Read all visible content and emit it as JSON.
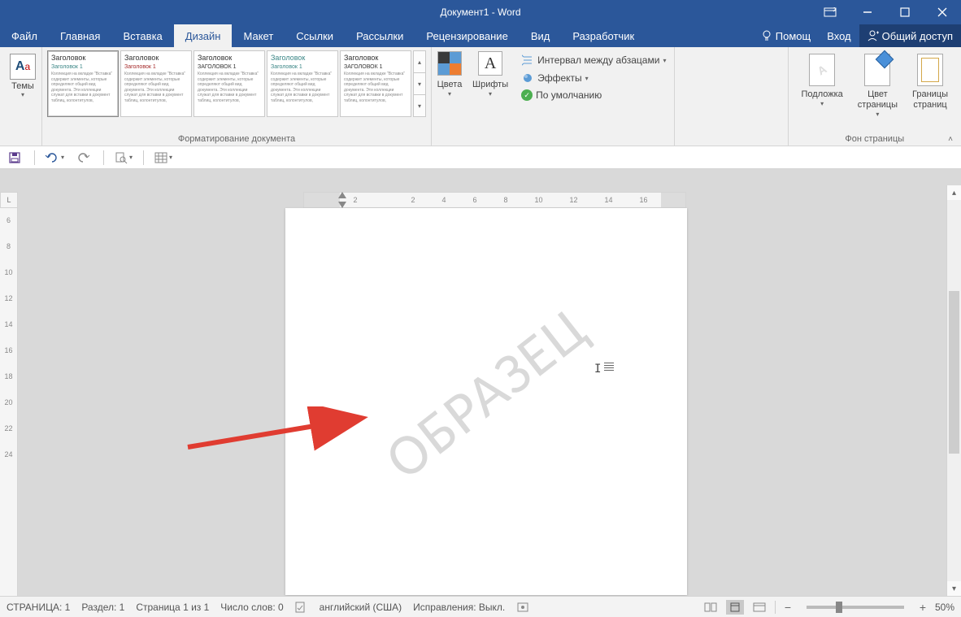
{
  "title": "Документ1 - Word",
  "window_controls": {
    "ribbon_opts": "ribbon-display-options",
    "min": "minimize",
    "max": "maximize",
    "close": "close"
  },
  "tabs": {
    "items": [
      "Файл",
      "Главная",
      "Вставка",
      "Дизайн",
      "Макет",
      "Ссылки",
      "Рассылки",
      "Рецензирование",
      "Вид",
      "Разработчик"
    ],
    "active_index": 3,
    "help": "Помощ",
    "signin": "Вход",
    "share": "Общий доступ"
  },
  "ribbon": {
    "themes_label": "Темы",
    "gallery": [
      {
        "heading": "Заголовок",
        "sub": "Заголовок 1",
        "subcolor": "teal"
      },
      {
        "heading": "Заголовок",
        "sub": "Заголовок 1",
        "subcolor": "red"
      },
      {
        "heading": "Заголовок",
        "sub": "ЗАГОЛОВОК 1",
        "subcolor": "dark"
      },
      {
        "heading": "Заголовок",
        "sub": "Заголовок 1",
        "subcolor": "teal"
      },
      {
        "heading": "Заголовок",
        "sub": "ЗАГОЛОВОК 1",
        "subcolor": "dark"
      }
    ],
    "gallery_item_body": "Коллекция на вкладке \"Вставка\" содержит элементы, которые определяют общий вид документа. Эти коллекции служат для вставки в документ таблиц, колонтитулов,",
    "format_group_label": "Форматирование документа",
    "colors_label": "Цвета",
    "fonts_label": "Шрифты",
    "paragraph_spacing": "Интервал между абзацами",
    "effects": "Эффекты",
    "set_default": "По умолчанию",
    "watermark_label": "Подложка",
    "page_color_label": "Цвет\nстраницы",
    "page_borders_label": "Границы\nстраниц",
    "page_background_group": "Фон страницы"
  },
  "qat": {
    "save": "save-icon",
    "undo": "undo-icon",
    "redo": "redo-icon",
    "find": "find-icon",
    "table": "table-icon"
  },
  "rulers": {
    "horizontal": [
      "2",
      "",
      "2",
      "4",
      "6",
      "8",
      "10",
      "12",
      "14",
      "16"
    ],
    "vertical": [
      "6",
      "8",
      "10",
      "12",
      "14",
      "16",
      "18",
      "20",
      "22",
      "24"
    ]
  },
  "document": {
    "watermark_text": "ОБРАЗЕЦ"
  },
  "status": {
    "page": "СТРАНИЦА: 1",
    "section": "Раздел: 1",
    "page_of": "Страница 1 из 1",
    "words": "Число слов: 0",
    "language": "английский (США)",
    "track_changes": "Исправления: Выкл.",
    "zoom": "50%"
  }
}
